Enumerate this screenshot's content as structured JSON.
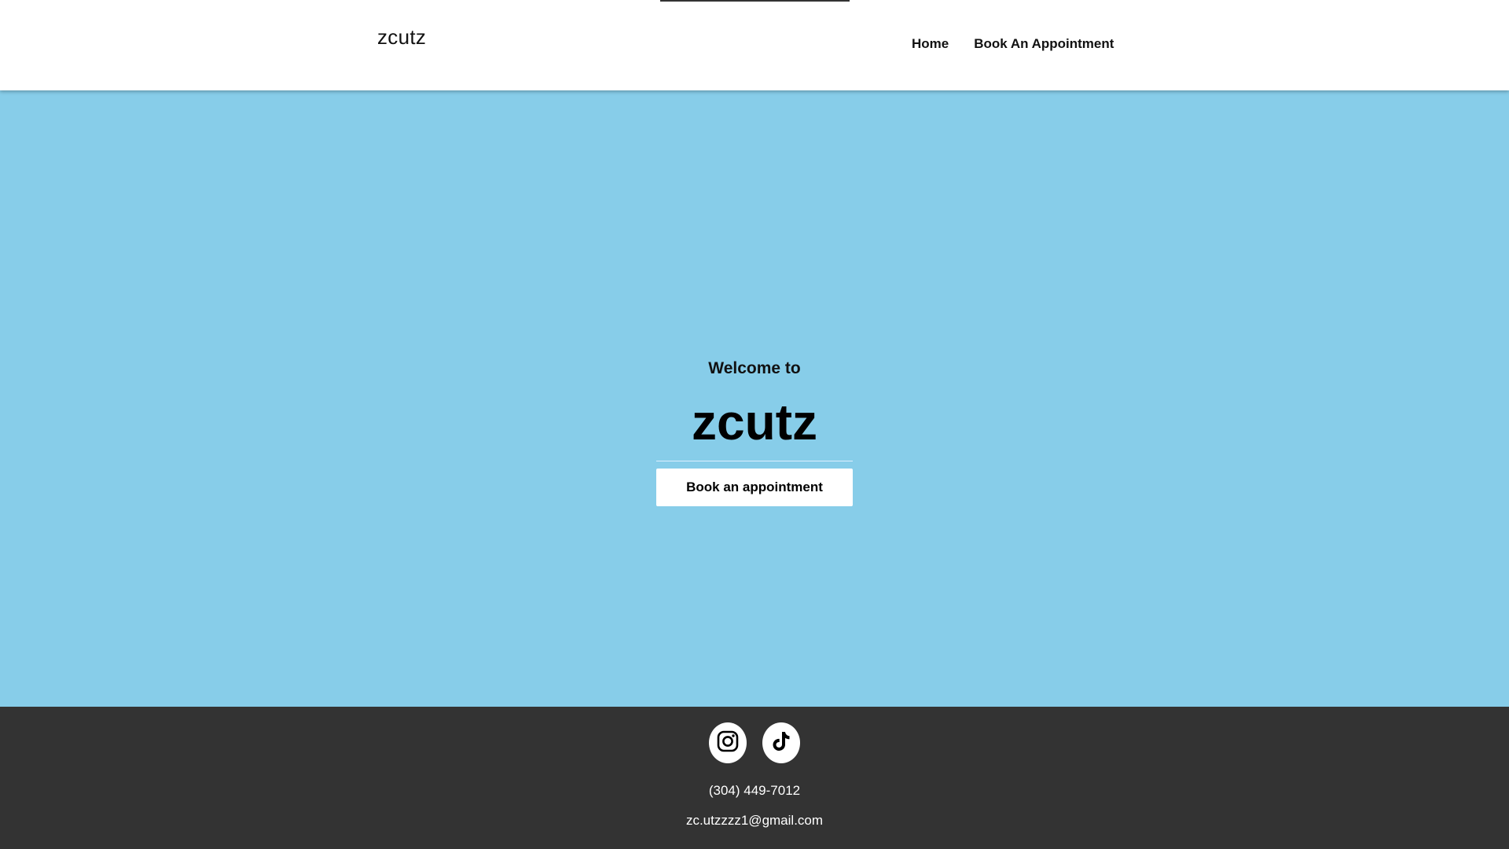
{
  "header": {
    "logo": "zcutz",
    "nav": [
      {
        "label": "Home"
      },
      {
        "label": "Book An Appointment"
      }
    ]
  },
  "hero": {
    "welcome": "Welcome to",
    "title": "zcutz",
    "button_label": "Book an appointment"
  },
  "footer": {
    "socials": [
      {
        "icon": "instagram-icon"
      },
      {
        "icon": "tiktok-icon"
      }
    ],
    "phone": "(304) 449-7012",
    "email": "zc.utzzzz1@gmail.com"
  },
  "colors": {
    "hero_background": "#87CDE9",
    "header_background": "#FFFFFF",
    "footer_background": "#333333",
    "button_background": "#FFFFFF"
  }
}
